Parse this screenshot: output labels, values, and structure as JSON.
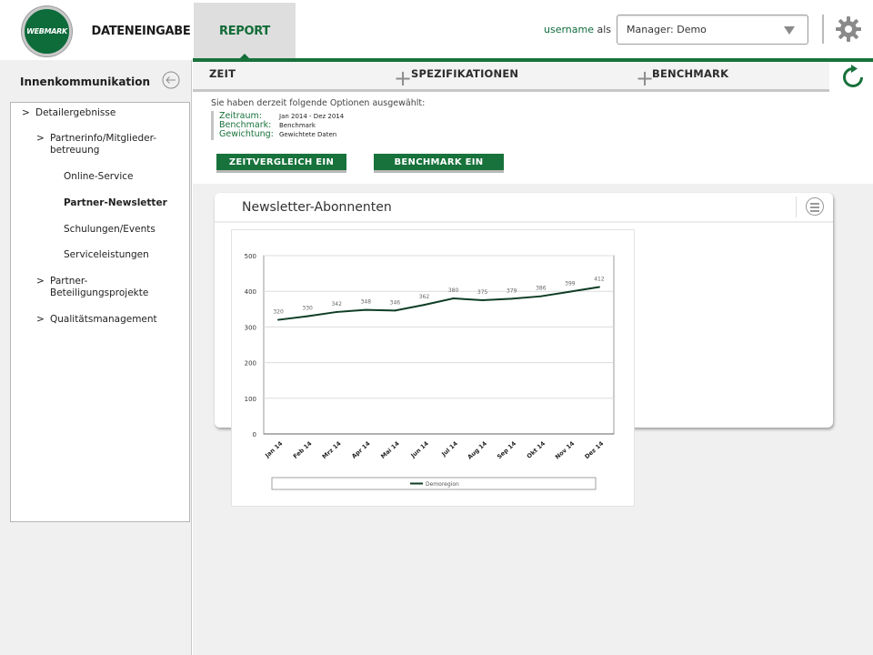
{
  "header": {
    "logo_text": "WEBMARK",
    "nav": [
      "DATENEINGABE",
      "REPORT"
    ],
    "active_tab": "REPORT",
    "user_label": "username",
    "user_suffix": "als",
    "manager_select": "Manager: Demo"
  },
  "colors": {
    "accent": "#17723b",
    "line": "#0f3d24"
  },
  "icons": {
    "settings": "gear-icon",
    "back": "arrow-left-circle-icon",
    "refresh": "refresh-icon",
    "menu": "hamburger-circle-icon"
  },
  "sidebar": {
    "title": "Innenkommunikation",
    "items": [
      {
        "prefix": ">",
        "label": "Detailergebnisse"
      },
      {
        "prefix": ">",
        "label": "Partnerinfo/Mitglieder-betreuung"
      },
      {
        "prefix": "",
        "label": "Online-Service"
      },
      {
        "prefix": "",
        "label": "Partner-Newsletter",
        "active": true
      },
      {
        "prefix": "",
        "label": "Schulungen/Events"
      },
      {
        "prefix": "",
        "label": "Serviceleistungen"
      },
      {
        "prefix": ">",
        "label": "Partner-Beteiligungsprojekte"
      },
      {
        "prefix": ">",
        "label": "Qualitätsmanagement"
      }
    ]
  },
  "steps": [
    "ZEIT",
    "SPEZIFIKATIONEN",
    "BENCHMARK"
  ],
  "options": {
    "title": "Sie haben derzeit folgende Optionen ausgewählt:",
    "rows": [
      {
        "key": "Zeitraum:",
        "value": "Jan 2014 - Dez 2014"
      },
      {
        "key": "Benchmark:",
        "value": "Benchmark"
      },
      {
        "key": "Gewichtung:",
        "value": "Gewichtete Daten"
      }
    ]
  },
  "buttons": {
    "zeitvergleich": "ZEITVERGLEICH EIN",
    "benchmark": "BENCHMARK EIN"
  },
  "card": {
    "title": "Newsletter-Abonnenten"
  },
  "chart_data": {
    "type": "line",
    "categories": [
      "Jan 14",
      "Feb 14",
      "Mrz 14",
      "Apr 14",
      "Mai 14",
      "Jun 14",
      "Jul 14",
      "Aug 14",
      "Sep 14",
      "Okt 14",
      "Nov 14",
      "Dez 14"
    ],
    "series": [
      {
        "name": "Demoregion",
        "values": [
          320,
          330,
          342,
          348,
          346,
          362,
          380,
          375,
          379,
          386,
          399,
          412
        ]
      }
    ],
    "yticks": [
      "0",
      "100",
      "200",
      "300",
      "400",
      "500"
    ],
    "ylim": [
      0,
      500
    ],
    "grid": true,
    "legend": "bottom"
  }
}
